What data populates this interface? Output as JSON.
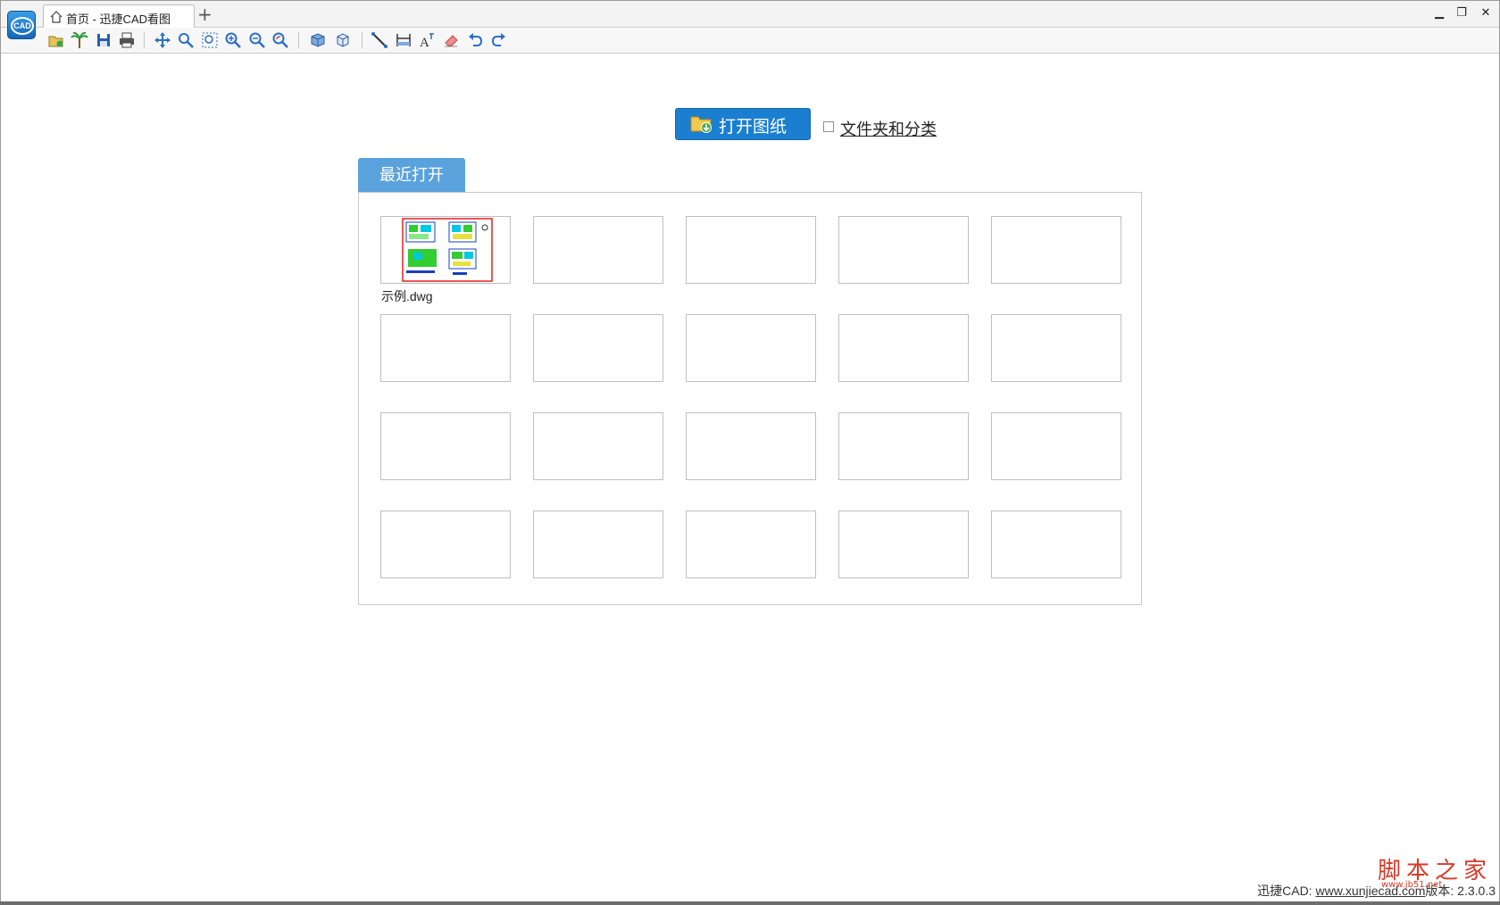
{
  "app": {
    "logo_text": "CAD"
  },
  "titlebar": {
    "tab_title": "首页 - 迅捷CAD看图",
    "new_tab": "+",
    "minimize": "▁",
    "restore": "❐",
    "close": "✕"
  },
  "toolbar": {
    "icons": [
      "open-icon",
      "palm-tree-icon",
      "save-icon",
      "print-icon",
      "pan-icon",
      "zoom-window-icon",
      "zoom-extents-icon",
      "zoom-in-icon",
      "zoom-out-icon",
      "zoom-previous-icon",
      "3d-view-icon",
      "3d-orbit-icon",
      "measure-line-icon",
      "measure-dimension-icon",
      "text-icon",
      "eraser-icon",
      "undo-icon",
      "redo-icon"
    ]
  },
  "main": {
    "open_button": "打开图纸",
    "folder_checkbox_label": "文件夹和分类",
    "recent_tab": "最近打开",
    "recent_files": [
      {
        "name": "示例.dwg",
        "has_preview": true
      }
    ]
  },
  "footer": {
    "prefix": "迅捷CAD: ",
    "url": "www.xunjiecad.com",
    "version": "版本: 2.3.0.3"
  },
  "watermark": {
    "title": "脚本之家",
    "sub": "www.jb51.net"
  },
  "colors": {
    "accent": "#1b7fd1",
    "recent_tab": "#5aa2dc",
    "watermark": "#d63a2a"
  }
}
